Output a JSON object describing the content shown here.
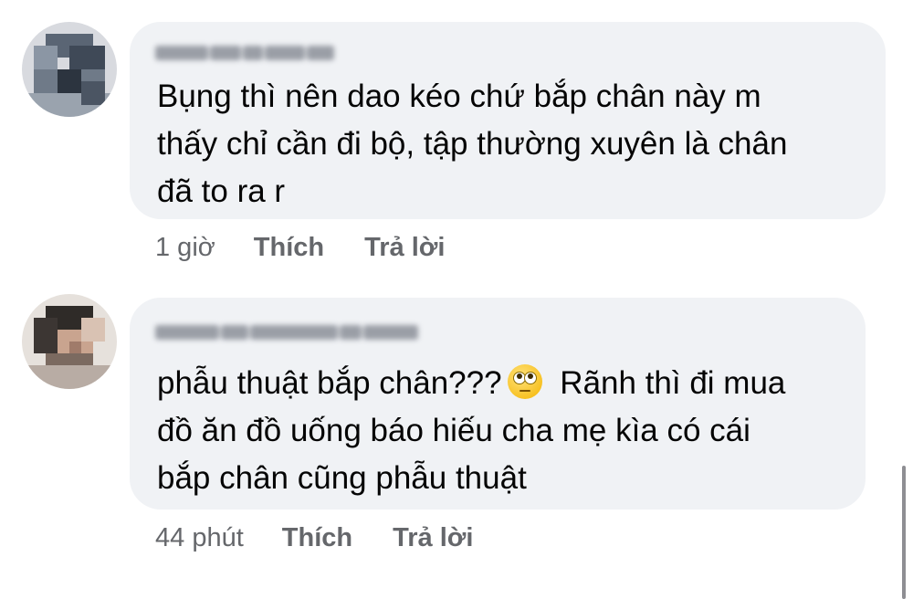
{
  "comments": [
    {
      "author": "",
      "text": "Bụng thì nên dao kéo chứ bắp chân này m\nthấy chỉ cần đi bộ, tập thường xuyên là chân\nđã to ra r",
      "time": "1 giờ",
      "like_label": "Thích",
      "reply_label": "Trả lời"
    },
    {
      "author": "",
      "text_before_emoji": "phẫu thuật bắp chân???",
      "emoji_icon": "face-with-rolling-eyes-icon",
      "text_after_emoji": " Rãnh thì đi mua\nđồ ăn đồ uống báo hiếu cha mẹ kìa có cái\nbắp chân cũng phẫu thuật",
      "time": "44 phút",
      "like_label": "Thích",
      "reply_label": "Trả lời"
    }
  ],
  "colors": {
    "bubble": "#f0f2f5",
    "text": "#050505",
    "meta": "#65676b"
  }
}
